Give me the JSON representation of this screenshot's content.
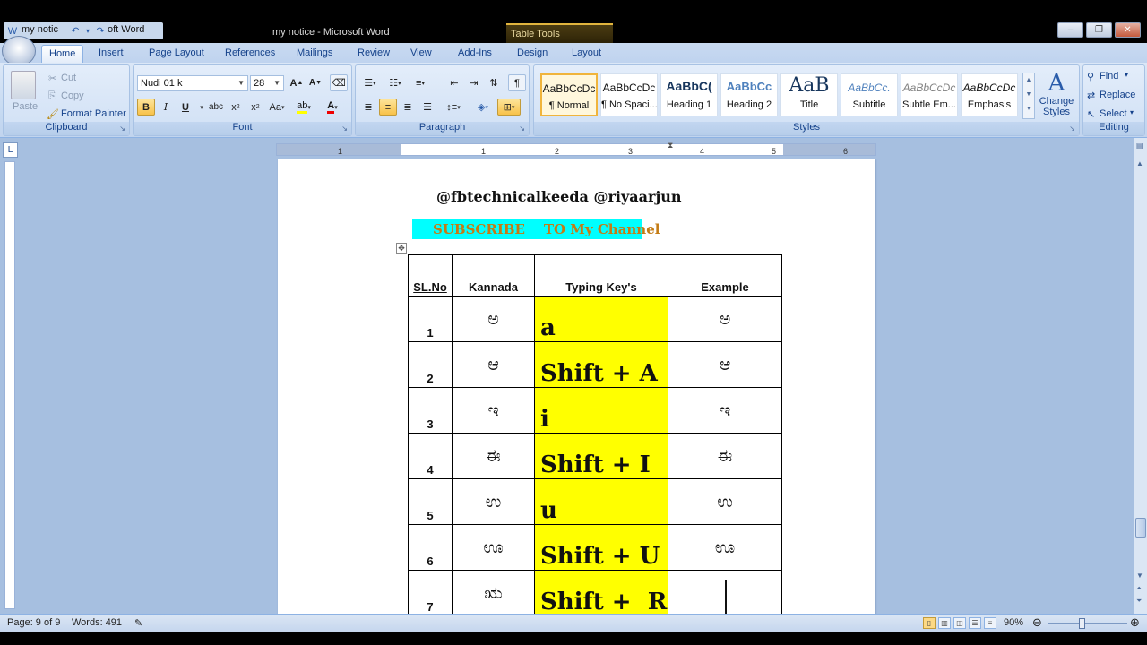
{
  "window": {
    "qat_title_fragment": "my notic",
    "qat_title_fragment2": "oft Word",
    "title": "my notice - Microsoft Word",
    "table_tools": "Table Tools",
    "minimize": "–",
    "restore": "❐",
    "close": "✕"
  },
  "tabs": [
    "Home",
    "Insert",
    "Page Layout",
    "References",
    "Mailings",
    "Review",
    "View",
    "Add-Ins",
    "Design",
    "Layout"
  ],
  "clipboard": {
    "paste": "Paste",
    "cut": "Cut",
    "copy": "Copy",
    "format_painter": "Format Painter",
    "label": "Clipboard"
  },
  "font": {
    "name": "Nudi 01 k",
    "size": "28",
    "label": "Font"
  },
  "paragraph": {
    "label": "Paragraph"
  },
  "styles": {
    "label": "Styles",
    "items": [
      {
        "preview": "AaBbCcDc",
        "name": "¶ Normal"
      },
      {
        "preview": "AaBbCcDc",
        "name": "¶ No Spaci..."
      },
      {
        "preview": "AaBbC(",
        "name": "Heading 1"
      },
      {
        "preview": "AaBbCc",
        "name": "Heading 2"
      },
      {
        "preview": "AaB",
        "name": "Title"
      },
      {
        "preview": "AaBbCc.",
        "name": "Subtitle"
      },
      {
        "preview": "AaBbCcDc",
        "name": "Subtle Em..."
      },
      {
        "preview": "AaBbCcDc",
        "name": "Emphasis"
      }
    ],
    "change_styles": "Change Styles"
  },
  "editing": {
    "find": "Find",
    "replace": "Replace",
    "select": "Select",
    "label": "Editing"
  },
  "ruler": {
    "corner": "L",
    "ticks": [
      "1",
      "1",
      "2",
      "3",
      "4",
      "5",
      "6"
    ]
  },
  "document": {
    "handles": "@fbtechnicalkeeda  @riyaarjun",
    "subscribe": "SUBSCRIBE    TO My Channel",
    "table": {
      "headers": [
        "SL.No",
        "Kannada",
        "Typing Key's",
        "Example"
      ],
      "rows": [
        {
          "no": "1",
          "kannada": "ಅ",
          "key": "a",
          "example": "ಅ"
        },
        {
          "no": "2",
          "kannada": "ಆ",
          "key": "Shift + A",
          "example": "ಆ"
        },
        {
          "no": "3",
          "kannada": "ಇ",
          "key": "i",
          "example": "ಇ"
        },
        {
          "no": "4",
          "kannada": "ಈ",
          "key": "Shift + I",
          "example": "ಈ"
        },
        {
          "no": "5",
          "kannada": "ಉ",
          "key": "u",
          "example": "ಉ"
        },
        {
          "no": "6",
          "kannada": "ಊ",
          "key": "Shift + U",
          "example": "ಊ"
        },
        {
          "no": "7",
          "kannada": "ಋ",
          "key": "Shift +  R",
          "example": ""
        }
      ]
    }
  },
  "status": {
    "page": "Page: 9 of 9",
    "words": "Words: 491",
    "zoom": "90%"
  }
}
